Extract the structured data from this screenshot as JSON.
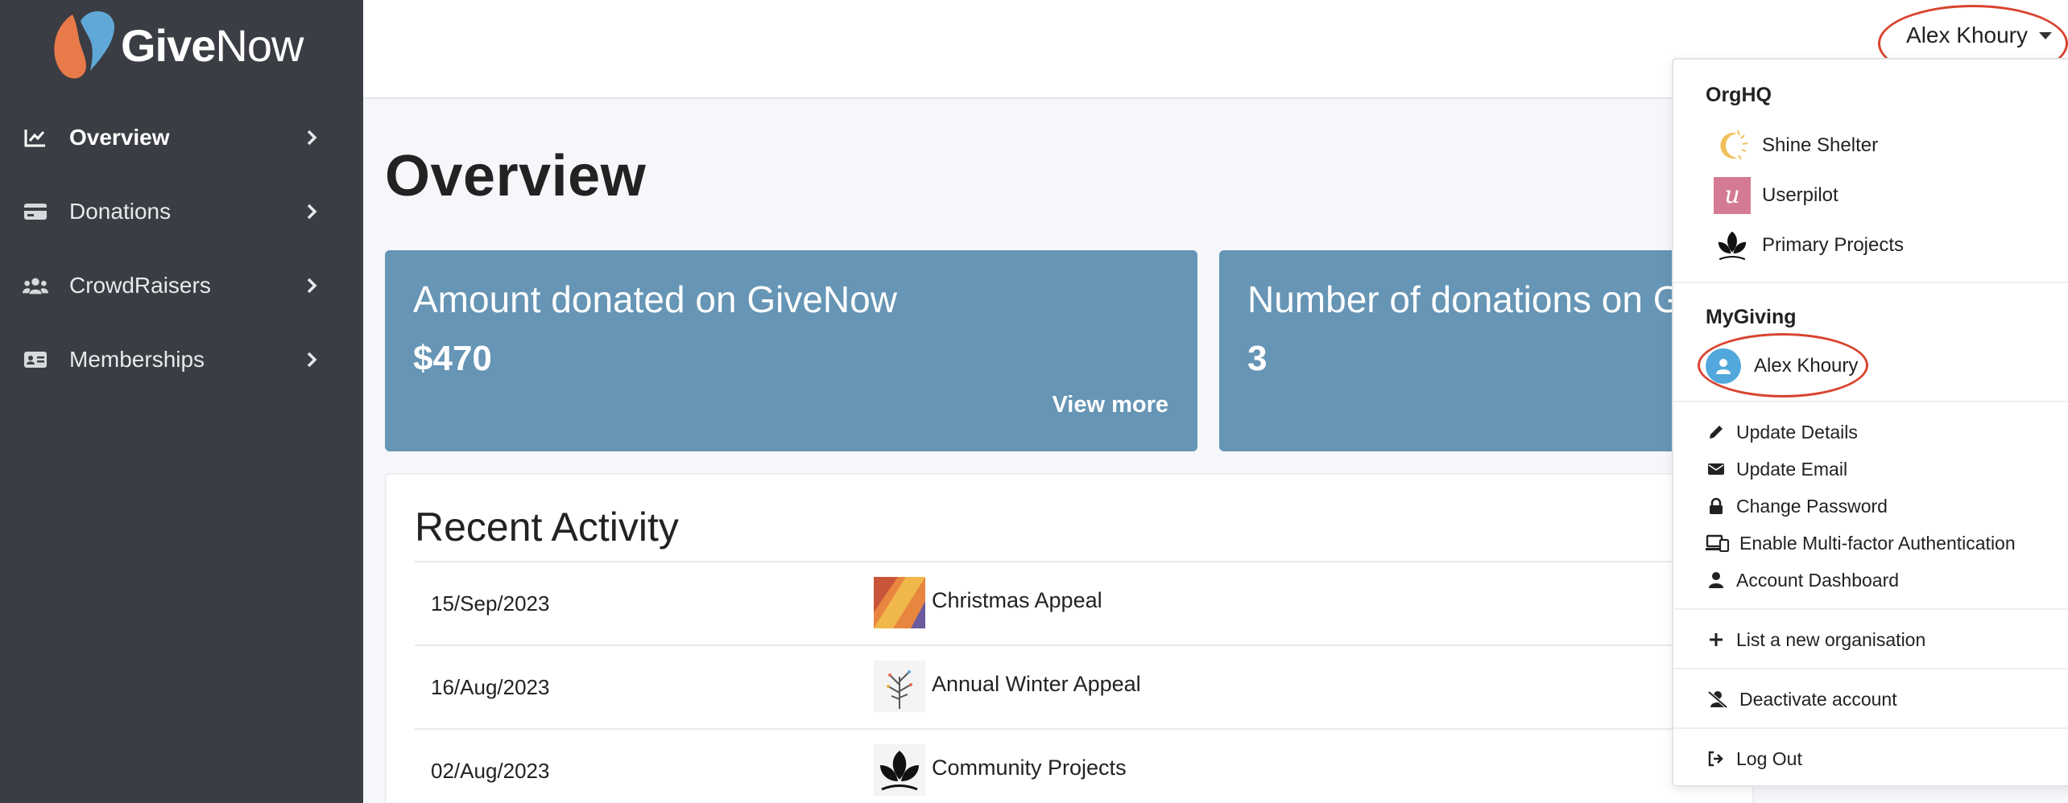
{
  "brand": {
    "name_bold": "Give",
    "name_light": "Now"
  },
  "sidebar": {
    "items": [
      {
        "label": "Overview",
        "icon": "chart-line-icon"
      },
      {
        "label": "Donations",
        "icon": "credit-card-icon"
      },
      {
        "label": "CrowdRaisers",
        "icon": "users-icon"
      },
      {
        "label": "Memberships",
        "icon": "id-card-icon"
      }
    ]
  },
  "header": {
    "user_name": "Alex Khoury"
  },
  "main": {
    "title": "Overview",
    "cards": [
      {
        "label": "Amount donated on GiveNow",
        "value": "$470",
        "link": "View more"
      },
      {
        "label": "Number of donations on GiveNow",
        "value": "3"
      }
    ],
    "activity": {
      "title": "Recent Activity",
      "rows": [
        {
          "date": "15/Sep/2023",
          "name": "Christmas Appeal"
        },
        {
          "date": "16/Aug/2023",
          "name": "Annual Winter Appeal"
        },
        {
          "date": "02/Aug/2023",
          "name": "Community Projects"
        }
      ]
    }
  },
  "dropdown": {
    "orghq_heading": "OrgHQ",
    "orgs": [
      {
        "name": "Shine Shelter"
      },
      {
        "name": "Userpilot",
        "logo_letter": "u"
      },
      {
        "name": "Primary Projects"
      }
    ],
    "mygiving_heading": "MyGiving",
    "profile_name": "Alex Khoury",
    "links": [
      {
        "label": "Update Details",
        "icon": "pencil-icon"
      },
      {
        "label": "Update Email",
        "icon": "envelope-icon"
      },
      {
        "label": "Change Password",
        "icon": "lock-icon"
      },
      {
        "label": "Enable Multi-factor Authentication",
        "icon": "devices-icon"
      },
      {
        "label": "Account Dashboard",
        "icon": "user-icon"
      }
    ],
    "list_org": "List a new organisation",
    "deactivate": "Deactivate account",
    "logout": "Log Out"
  },
  "colors": {
    "sidebar_bg": "#3a3d43",
    "card_bg": "#6695b5",
    "highlight_ring": "#d9442f",
    "avatar_bg": "#52a8dc"
  }
}
